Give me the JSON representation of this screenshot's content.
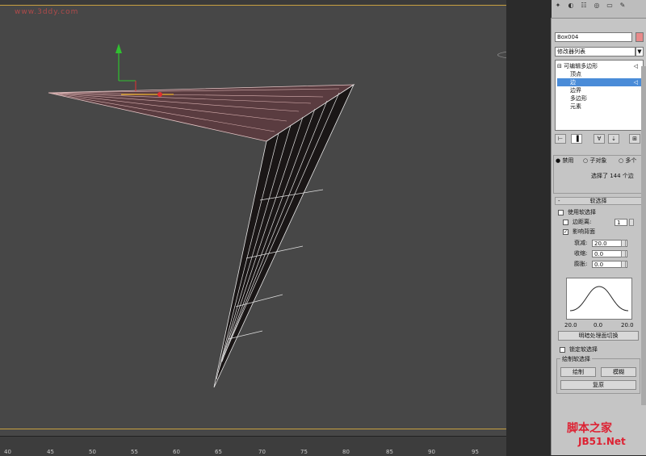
{
  "watermark_top": "www.3ddy.com",
  "viewport": {
    "timeline_ticks": [
      "40",
      "45",
      "50",
      "55",
      "60",
      "65",
      "70",
      "75",
      "80",
      "85",
      "90",
      "95"
    ]
  },
  "panel": {
    "tabs": [
      "create-icon",
      "modify-icon",
      "hierarchy-icon",
      "motion-icon",
      "display-icon",
      "utilities-icon"
    ],
    "object_name": "Box004",
    "object_color": "#e88a8a",
    "modifier_list": "修改器列表",
    "stack": {
      "root": "可编辑多边形",
      "items": [
        "顶点",
        "边",
        "边界",
        "多边形",
        "元素"
      ],
      "selected": 1
    },
    "selection": {
      "radio_off": "禁用",
      "radio_sub": "子对象",
      "radio_multi": "多个",
      "status": "选择了 144 个边"
    },
    "soft_selection": {
      "header": "软选择",
      "use_soft": "使用软选择",
      "edge_distance": "边距离:",
      "edge_distance_value": "1",
      "affect_backfacing": "影响背面",
      "falloff_label": "衰减:",
      "falloff_value": "20.0",
      "pinch_label": "收缩:",
      "pinch_value": "0.0",
      "bubble_label": "膨胀:",
      "bubble_value": "0.0",
      "curve_left": "20.0",
      "curve_mid": "0.0",
      "curve_right": "20.0",
      "shaded_face_toggle": "明暗处理面切换",
      "lock_soft": "锁定软选择",
      "paint_soft_header": "绘制软选择",
      "paint_btn": "绘制",
      "blur_btn": "模糊",
      "revert_btn": "复原"
    }
  },
  "watermark_bottom": "脚本之家",
  "watermark_bottom2": "JB51.Net",
  "colors": {
    "selection_blue": "#4a8cd8",
    "viewport_bg": "#474747",
    "highlight_red": "#e03030"
  }
}
